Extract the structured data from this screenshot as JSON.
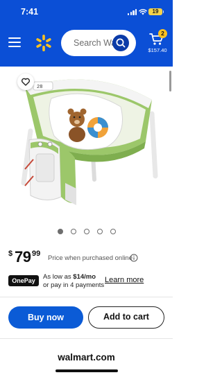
{
  "status_bar": {
    "time": "7:41",
    "battery": "19"
  },
  "header": {
    "background_color": "#0b4fd6",
    "logo": "walmart-spark-icon",
    "search": {
      "placeholder": "Search Walmart",
      "icon": "search-icon"
    },
    "cart": {
      "count": "2",
      "total": "$157.40",
      "icon": "cart-icon"
    }
  },
  "product": {
    "image_description_icon": "product-image",
    "favorite_icon": "heart-icon",
    "carousel": {
      "count": 5,
      "active_index": 0
    },
    "price": {
      "currency": "$",
      "whole": "79",
      "cents": "99",
      "note": "Price when purchased online"
    }
  },
  "onepay": {
    "badge": "OnePay",
    "line1_prefix": "As low as ",
    "line1_amount": "$14/mo",
    "line2": "or pay in 4 payments",
    "learn_more": "Learn more"
  },
  "actions": {
    "buy_now": "Buy now",
    "add_to_cart": "Add to cart",
    "accent_color": "#0b5bd6"
  },
  "browser": {
    "url": "walmart.com"
  }
}
